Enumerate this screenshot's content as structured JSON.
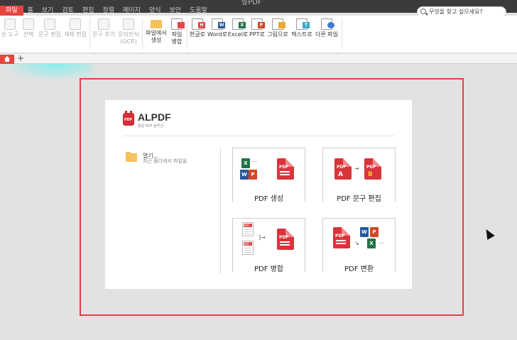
{
  "window": {
    "title": "알PDF"
  },
  "menu": [
    "파일",
    "홈",
    "보기",
    "검토",
    "편집",
    "정렬",
    "페이지",
    "양식",
    "보안",
    "도움말"
  ],
  "search": {
    "placeholder": "무엇을 찾고 싶으세요?"
  },
  "ribbon": {
    "tools": [
      {
        "label": "손 도구"
      },
      {
        "label": "선택"
      },
      {
        "label": "문구 편집"
      },
      {
        "label": "개체 편집"
      },
      {
        "label": "문구 추가"
      },
      {
        "label": "문자인식",
        "sub": "(OCR)"
      },
      {
        "label": "파일에서",
        "sub": "생성"
      },
      {
        "label": "파일",
        "sub": "병합"
      }
    ],
    "convert": [
      {
        "label": "한글로",
        "tag": "H",
        "color": "#e4474b"
      },
      {
        "label": "Word로",
        "tag": "W",
        "color": "#2b579a"
      },
      {
        "label": "Excel로",
        "tag": "X",
        "color": "#217346"
      },
      {
        "label": "PPT로",
        "tag": "P",
        "color": "#d24726"
      },
      {
        "label": "그림으로",
        "tag": "",
        "color": "#f0a830"
      },
      {
        "label": "텍스트로",
        "tag": "T",
        "color": "#3aa6c9"
      },
      {
        "label": "다른 파일",
        "tag": "",
        "color": "#3a7fd5"
      }
    ]
  },
  "tabs": {
    "new_tab": "+"
  },
  "home": {
    "brand": "ALPDF",
    "logo_text": "PDF",
    "brand_sub": "통합 PDF 솔루션",
    "open_label": "열기...",
    "open_desc": "최근 폴더에서 파일을",
    "features": [
      {
        "label": "PDF 생성"
      },
      {
        "label": "PDF 문구 편집"
      },
      {
        "label": "PDF 병합"
      },
      {
        "label": "PDF 변환"
      }
    ],
    "icon_text": {
      "pdf": "PDF",
      "ellipsis": "...",
      "x": "X",
      "w": "W",
      "p": "P",
      "a": "A",
      "b": "B",
      "arrow": "→",
      "bracket": "]→",
      "diag": "↘"
    }
  },
  "colors": {
    "accent": "#e8443f",
    "frame": "#e04048"
  }
}
